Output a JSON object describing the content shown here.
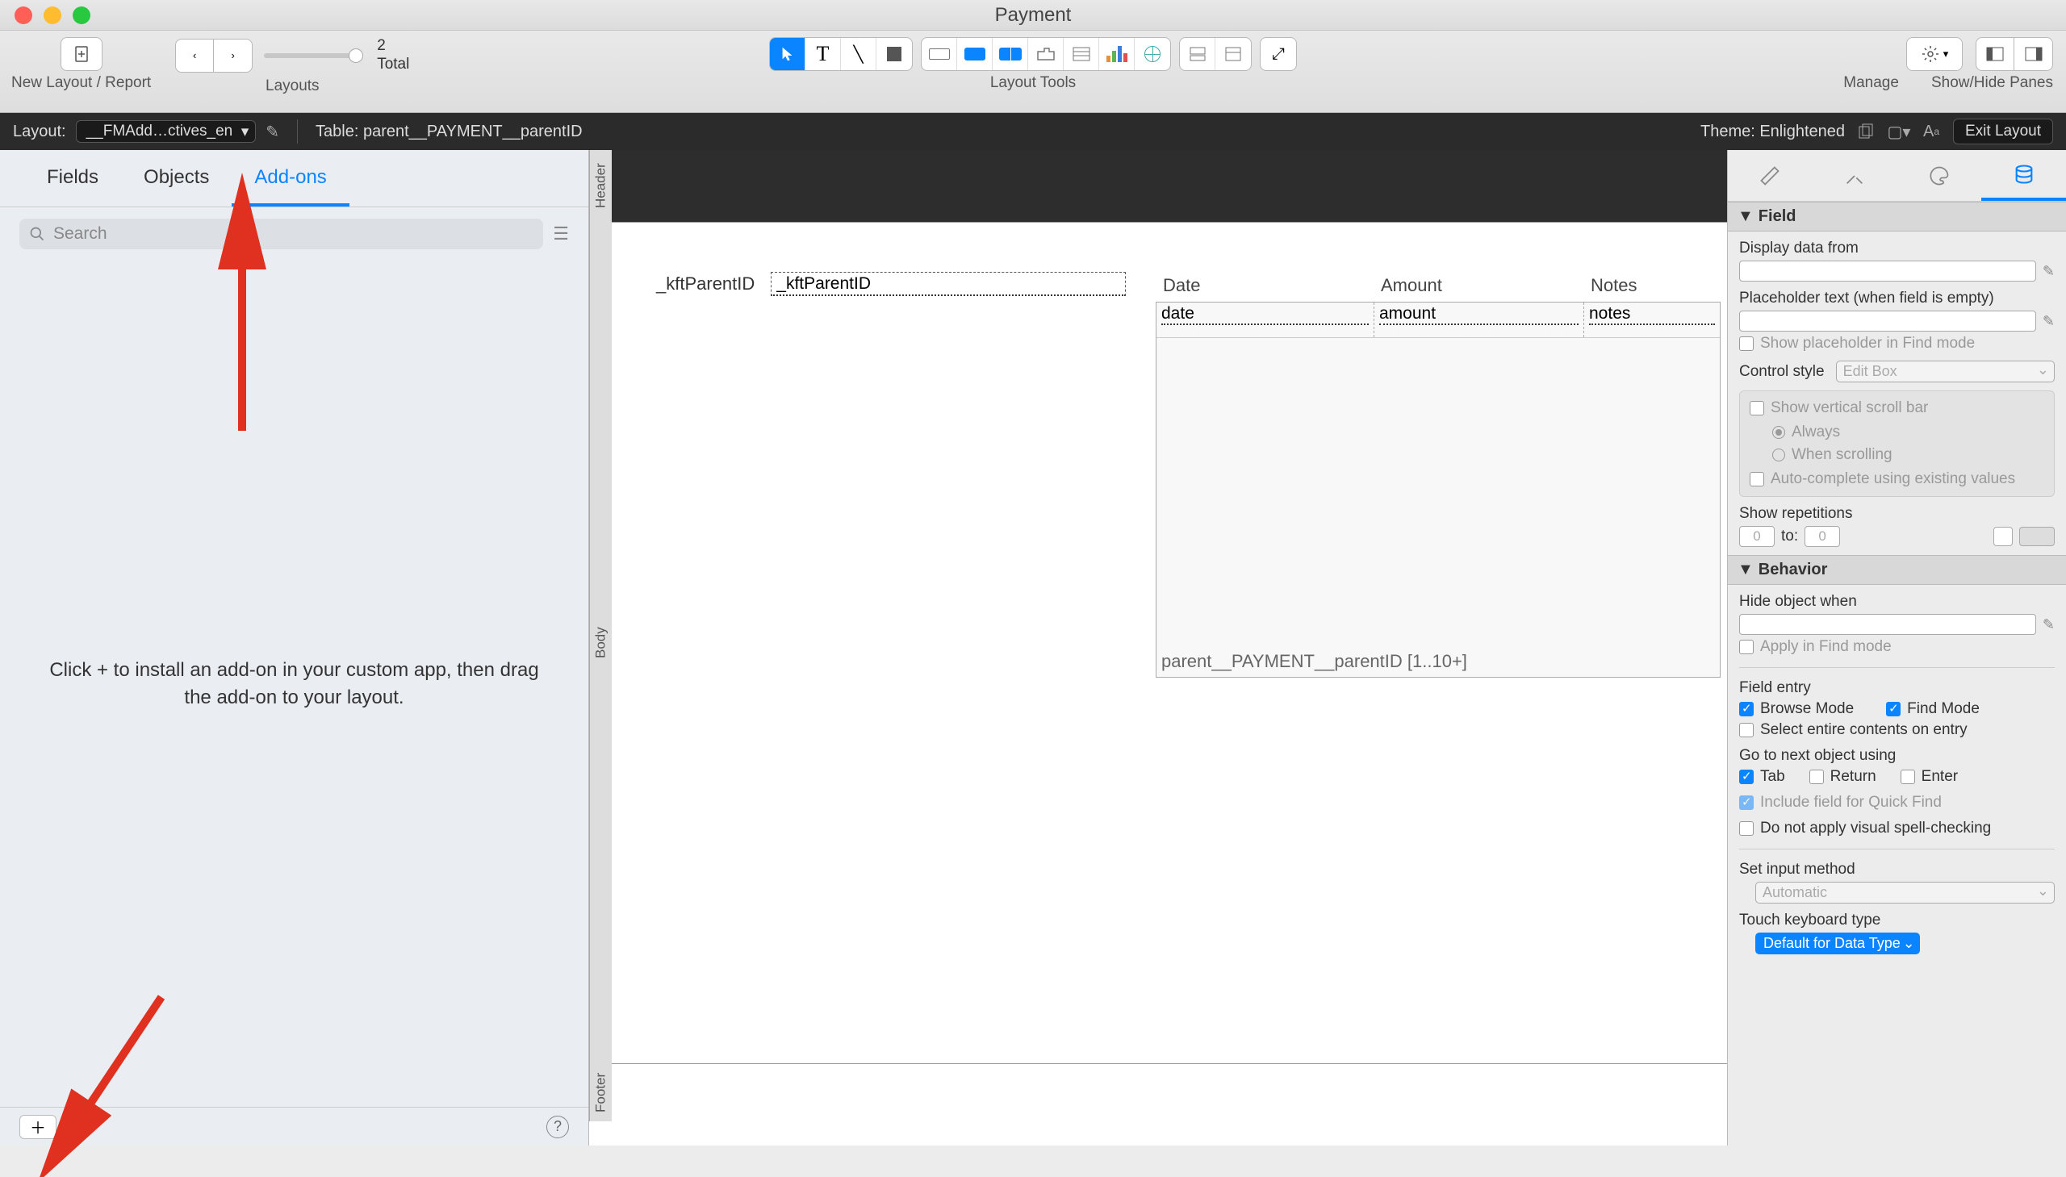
{
  "window": {
    "title": "Payment"
  },
  "toolbar": {
    "new_layout_label": "New Layout / Report",
    "layouts_label": "Layouts",
    "count_num": "2",
    "count_total": "Total",
    "tools_label": "Layout Tools",
    "manage_label": "Manage",
    "panes_label": "Show/Hide Panes"
  },
  "statusbar": {
    "layout_label": "Layout:",
    "layout_value": "__FMAdd…ctives_en",
    "table_label": "Table: parent__PAYMENT__parentID",
    "theme_label": "Theme: Enlightened",
    "exit_label": "Exit Layout"
  },
  "left": {
    "tabs": {
      "fields": "Fields",
      "objects": "Objects",
      "addons": "Add-ons"
    },
    "search_placeholder": "Search",
    "empty_msg": "Click + to install an add-on in your custom app, then drag the add-on to your layout."
  },
  "canvas": {
    "parts": {
      "header": "Header",
      "body": "Body",
      "footer": "Footer"
    },
    "field1_label": "_kftParentID",
    "field1_value": "_kftParentID",
    "portal": {
      "headers": {
        "date": "Date",
        "amount": "Amount",
        "notes": "Notes"
      },
      "cells": {
        "date": "date",
        "amount": "amount",
        "notes": "notes"
      },
      "label": "parent__PAYMENT__parentID [1..10+]"
    }
  },
  "inspector": {
    "section_field": "Field",
    "display_data_label": "Display data from",
    "placeholder_label": "Placeholder text (when field is empty)",
    "show_placeholder": "Show placeholder in Find mode",
    "control_style_label": "Control style",
    "control_style_value": "Edit Box",
    "scrollbar": "Show vertical scroll bar",
    "always": "Always",
    "when_scrolling": "When scrolling",
    "autocomplete": "Auto-complete using existing values",
    "show_reps_label": "Show repetitions",
    "rep_from": "0",
    "rep_to_label": "to:",
    "rep_to": "0",
    "section_behavior": "Behavior",
    "hide_label": "Hide object when",
    "apply_find": "Apply in Find mode",
    "field_entry_label": "Field entry",
    "browse_mode": "Browse Mode",
    "find_mode": "Find Mode",
    "select_contents": "Select entire contents on entry",
    "goto_label": "Go to next object using",
    "tab": "Tab",
    "return": "Return",
    "enter": "Enter",
    "quick_find": "Include field for Quick Find",
    "spell": "Do not apply visual spell-checking",
    "input_method_label": "Set input method",
    "input_method_value": "Automatic",
    "keyboard_label": "Touch keyboard type",
    "keyboard_value": "Default for Data Type"
  }
}
